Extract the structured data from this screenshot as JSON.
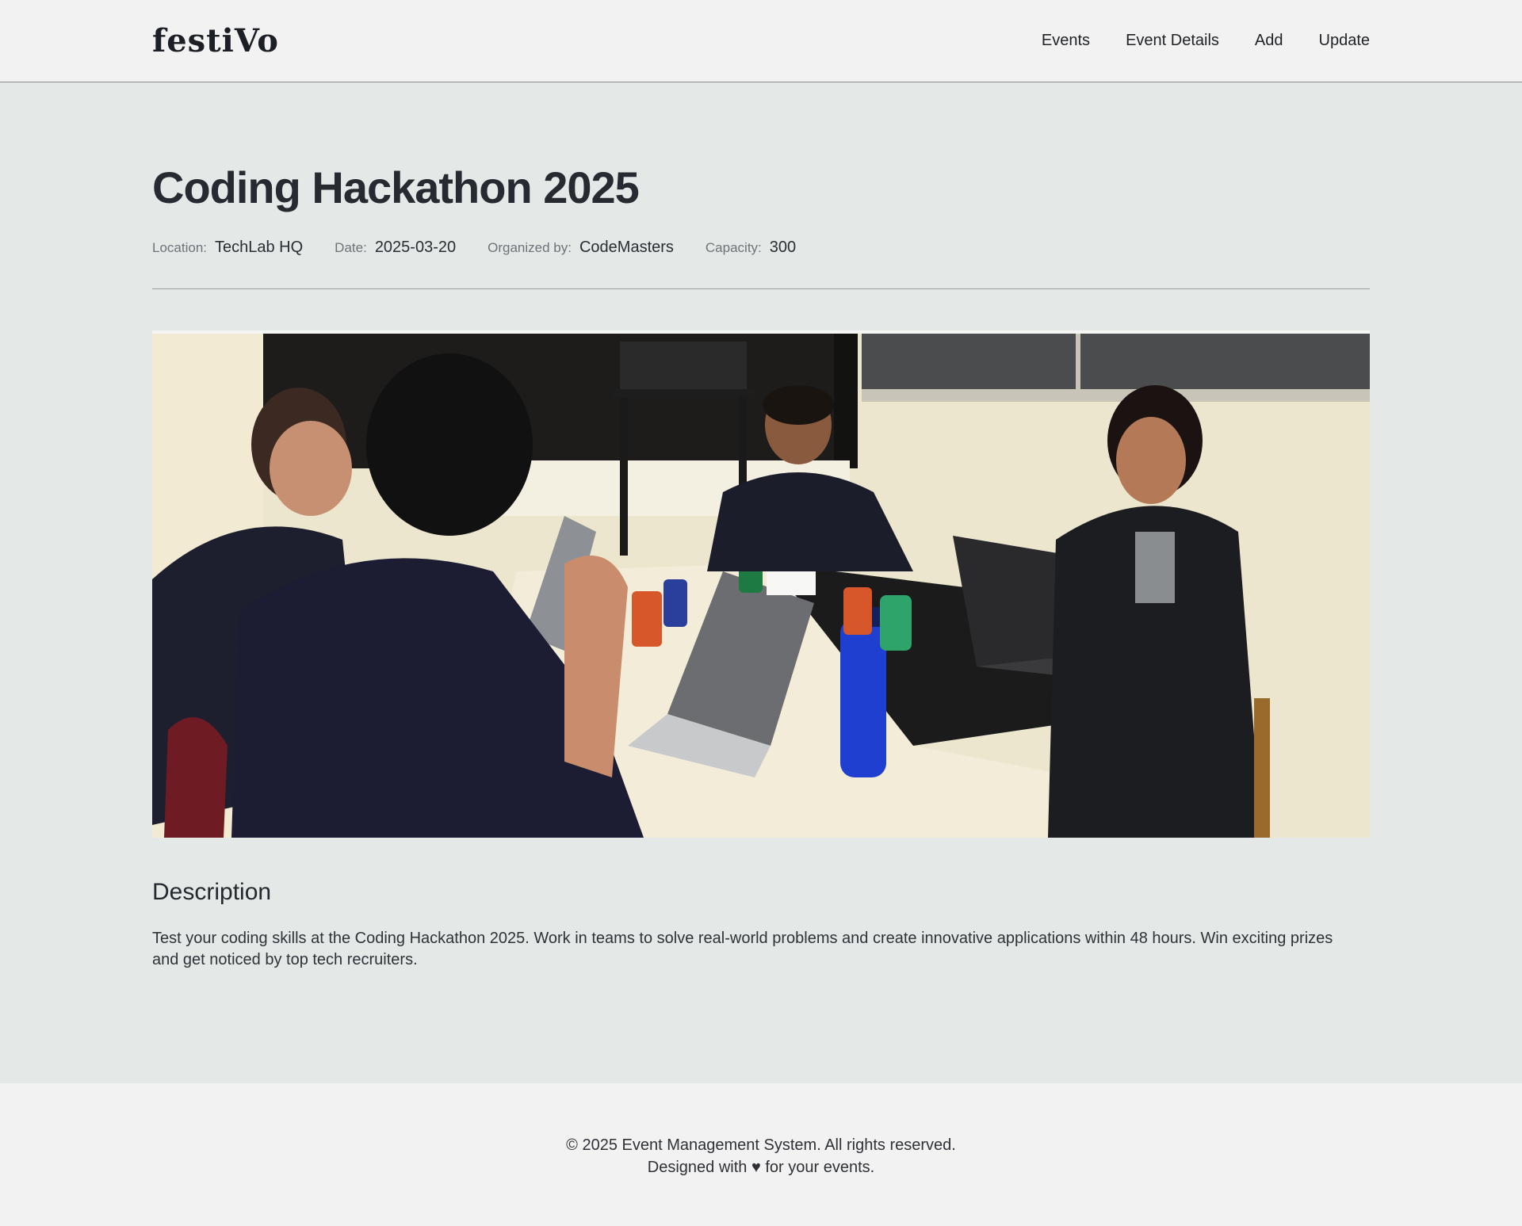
{
  "header": {
    "logo": "festiVo",
    "nav": [
      "Events",
      "Event Details",
      "Add",
      "Update"
    ]
  },
  "event": {
    "title": "Coding Hackathon 2025",
    "meta": [
      {
        "label": "Location:",
        "value": "TechLab HQ"
      },
      {
        "label": "Date:",
        "value": "2025-03-20"
      },
      {
        "label": "Organized by:",
        "value": "CodeMasters"
      },
      {
        "label": "Capacity:",
        "value": "300"
      }
    ],
    "image_description": "Photo of people working on laptops around a table",
    "description_heading": "Description",
    "description": "Test your coding skills at the Coding Hackathon 2025. Work in teams to solve real-world problems and create innovative applications within 48 hours. Win exciting prizes and get noticed by top tech recruiters."
  },
  "footer": {
    "line1": "© 2025 Event Management System. All rights reserved.",
    "line2": "Designed with ♥ for your events."
  }
}
